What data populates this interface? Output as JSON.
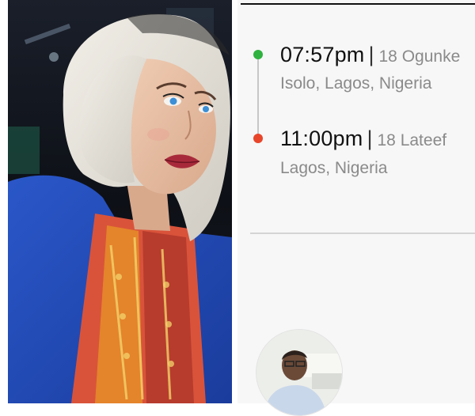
{
  "trip": {
    "pickup": {
      "time": "07:57pm",
      "separator": "|",
      "address_line1": "18 Ogunke",
      "address_line2": "Isolo, Lagos, Nigeria",
      "marker_color": "#2fb23f"
    },
    "dropoff": {
      "time": "11:00pm",
      "separator": "|",
      "address_line1": "18 Lateef",
      "address_line2": "Lagos, Nigeria",
      "marker_color": "#e8462b"
    }
  }
}
